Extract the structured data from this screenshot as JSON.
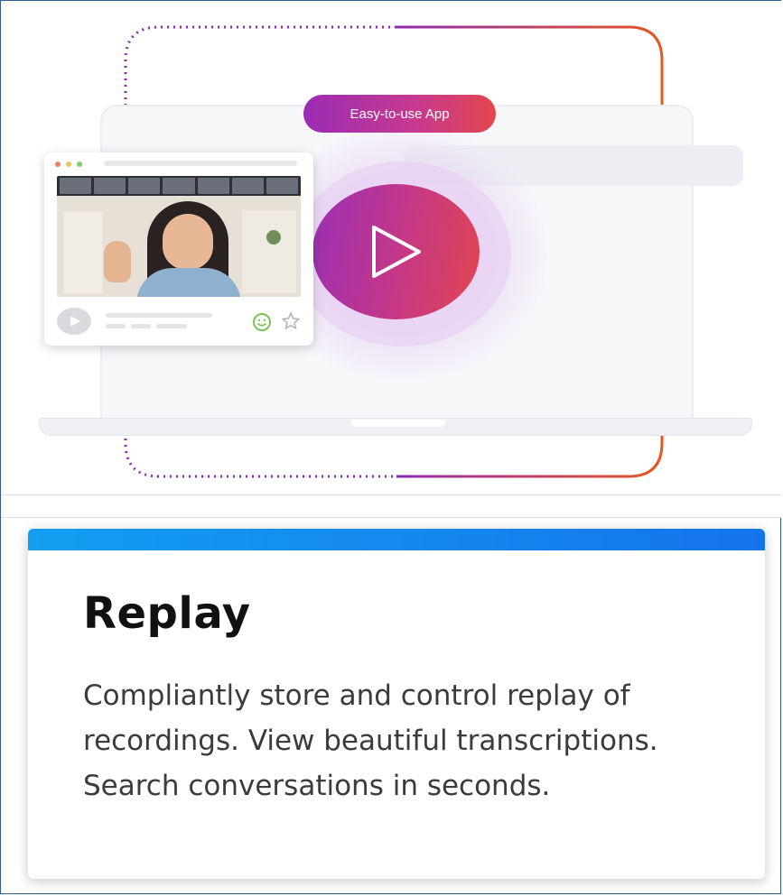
{
  "illustration": {
    "pill_label": "Easy-to-use App",
    "play_icon": "play-icon",
    "card_icons": [
      "play-icon",
      "smile-icon",
      "star-icon"
    ]
  },
  "card": {
    "title": "Replay",
    "description": "Compliantly store and control replay of recordings. View beautiful transcriptions. Search conversations in seconds."
  },
  "colors": {
    "accent_blue": "#1474ec",
    "gradient_purple": "#9a2cb4",
    "gradient_orange": "#e2464d",
    "outline_orange": "#e8561f"
  }
}
